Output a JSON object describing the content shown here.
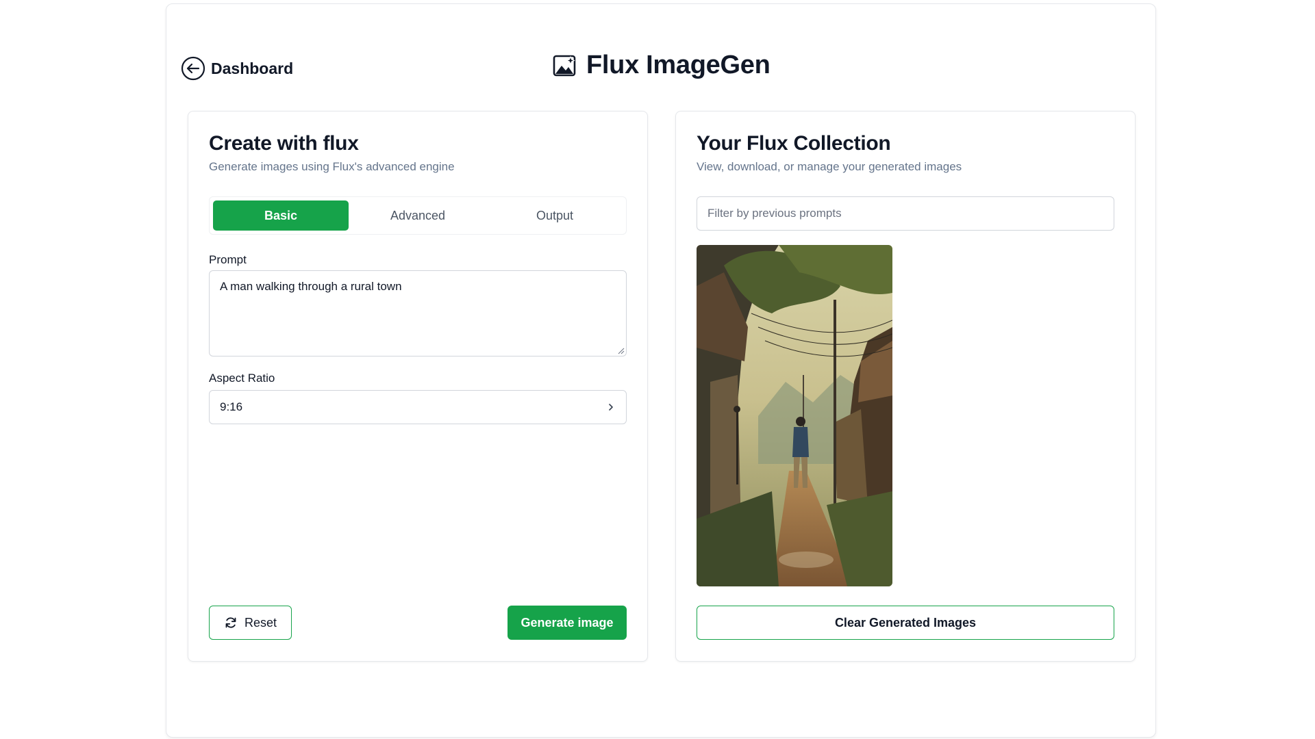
{
  "header": {
    "back_label": "Dashboard",
    "back_icon": "arrow-left-circle-icon",
    "app_title": "Flux ImageGen",
    "app_icon": "image-sparkle-icon"
  },
  "create_panel": {
    "title": "Create with flux",
    "subtitle": "Generate images using Flux's advanced engine",
    "tabs": [
      {
        "label": "Basic",
        "active": true
      },
      {
        "label": "Advanced",
        "active": false
      },
      {
        "label": "Output",
        "active": false
      }
    ],
    "prompt_label": "Prompt",
    "prompt_value": "A man walking through a rural town",
    "aspect_label": "Aspect Ratio",
    "aspect_value": "9:16",
    "reset_label": "Reset",
    "generate_label": "Generate image"
  },
  "collection_panel": {
    "title": "Your Flux Collection",
    "subtitle": "View, download, or manage your generated images",
    "filter_placeholder": "Filter by previous prompts",
    "clear_label": "Clear Generated Images"
  },
  "colors": {
    "accent": "#16a34a",
    "muted_text": "#64748b",
    "border": "#d1d5db"
  }
}
